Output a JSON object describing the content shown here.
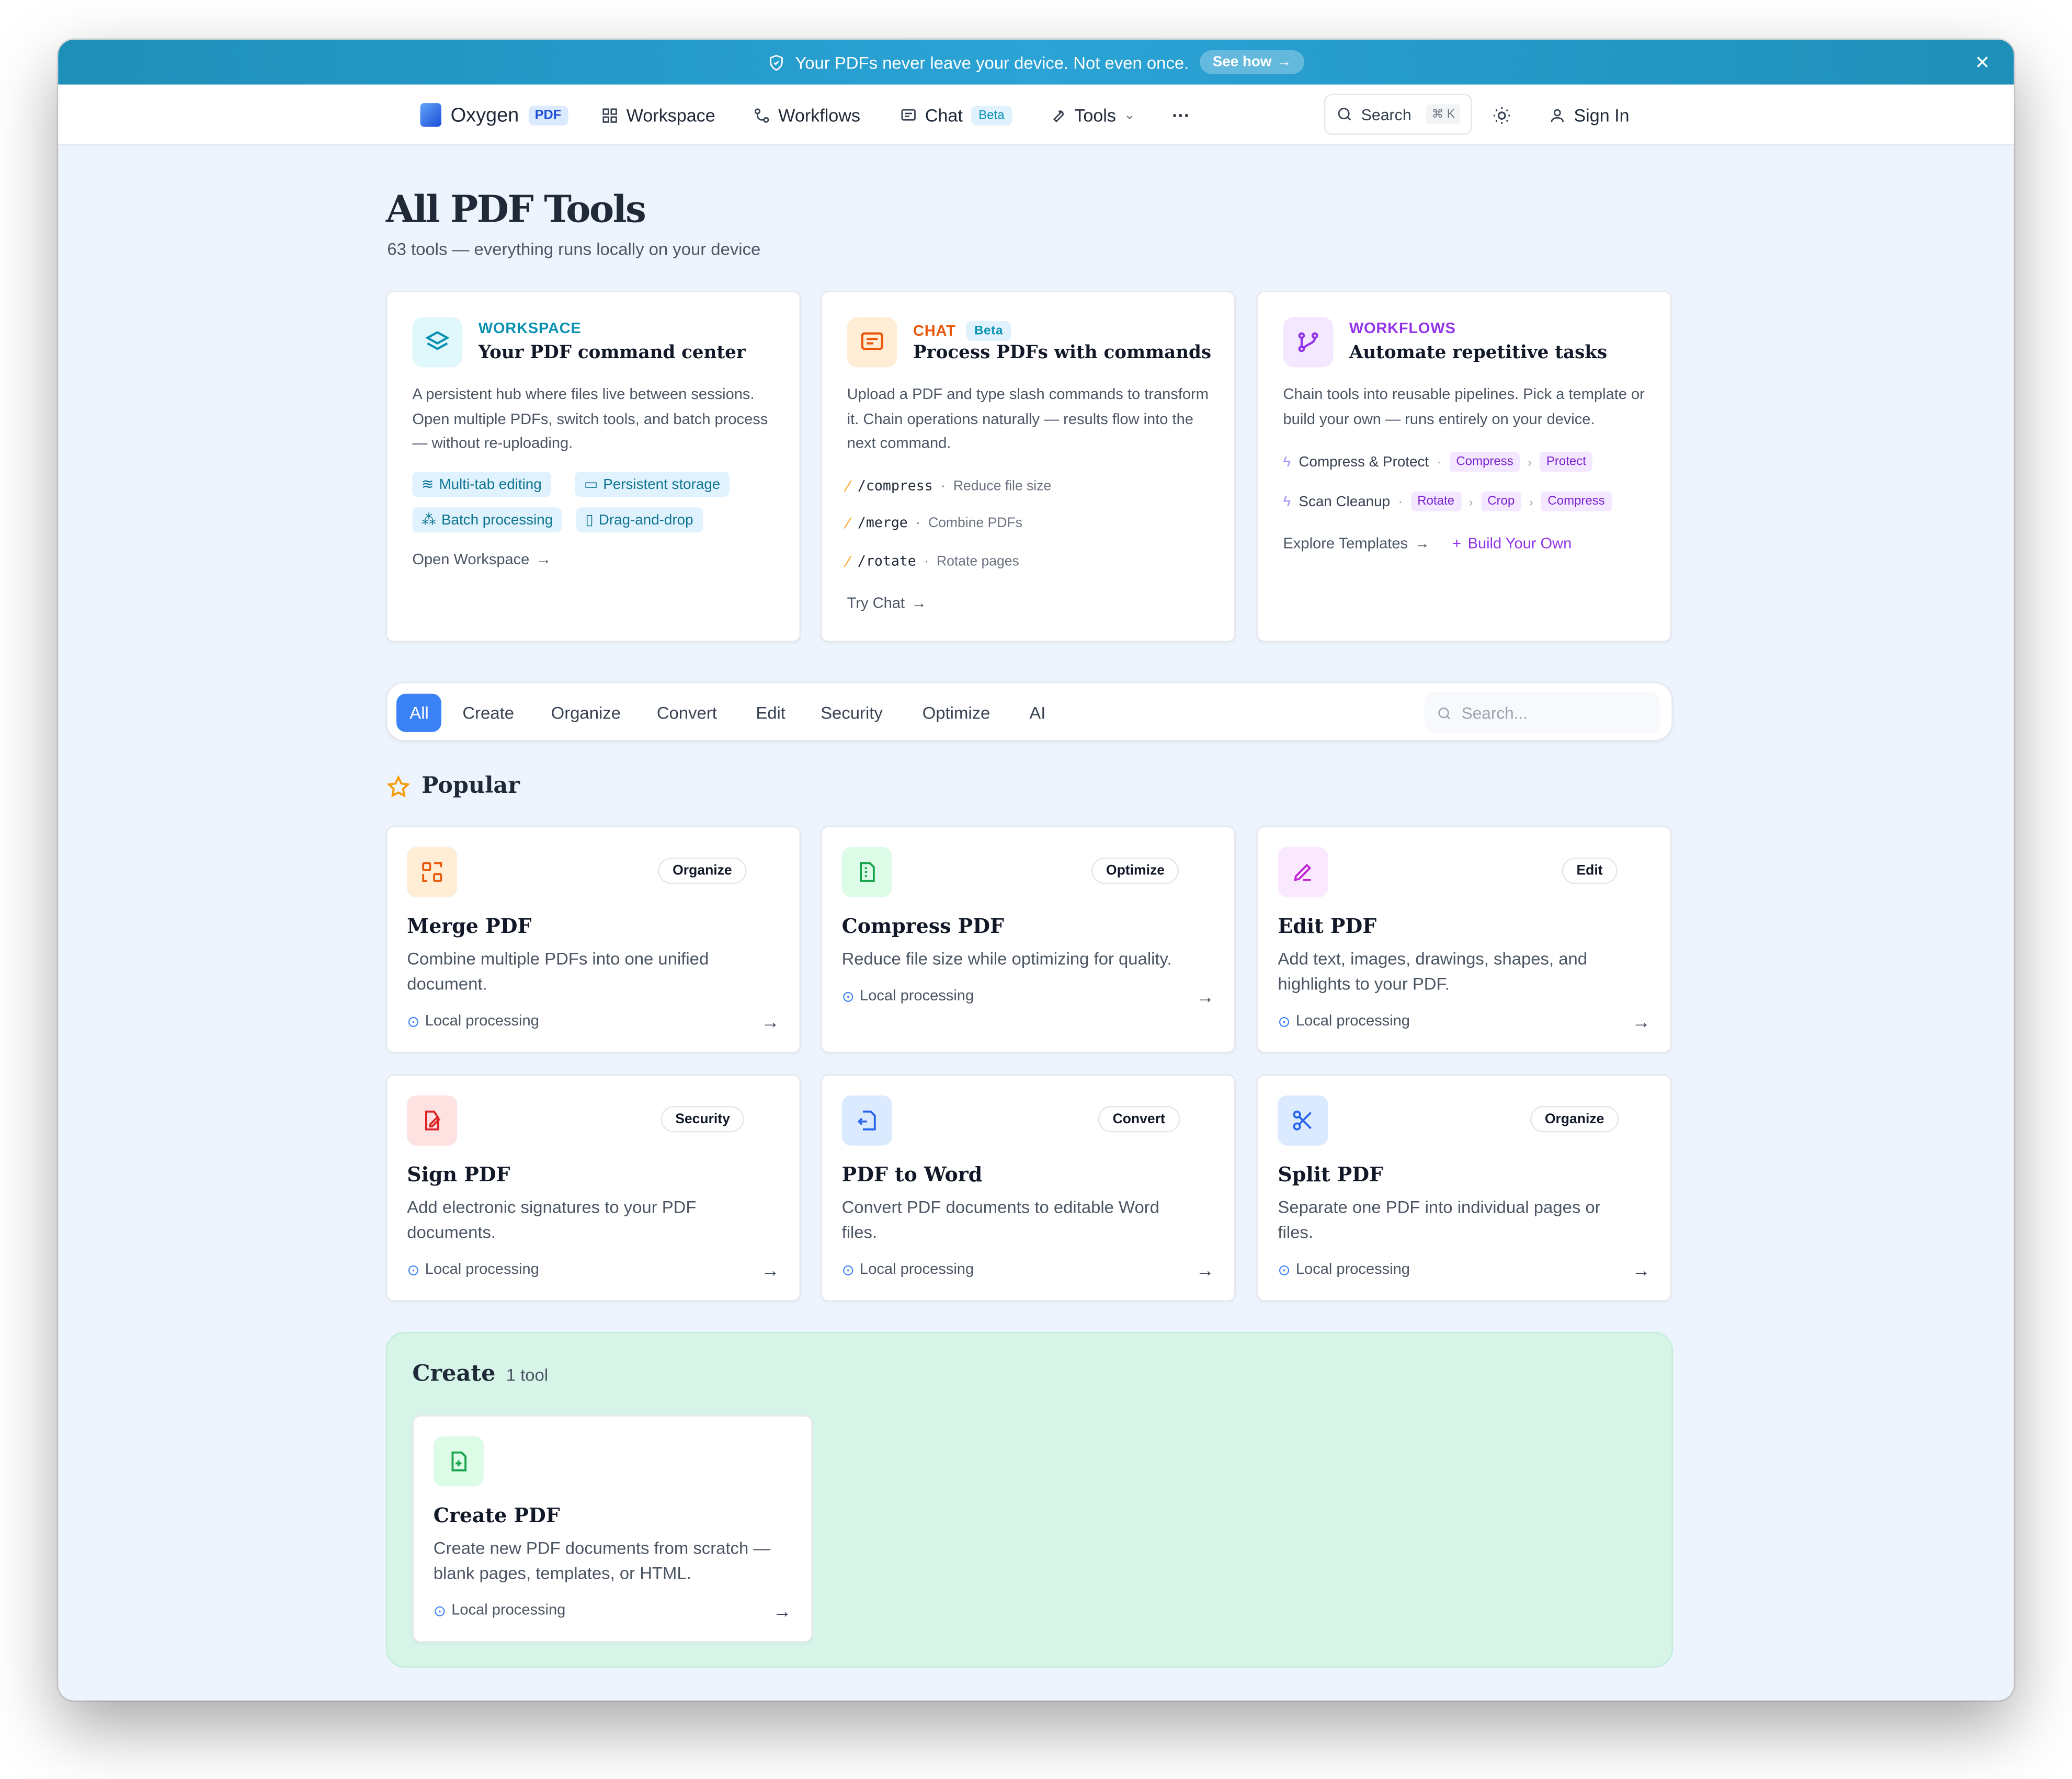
{
  "banner": {
    "text": "Your PDFs never leave your device. Not even once.",
    "see_how": "See how",
    "shield_icon": "shield-icon",
    "close_icon": "close-icon"
  },
  "nav": {
    "brand": "Oxygen",
    "brand_badge": "PDF",
    "workspace": "Workspace",
    "workflows": "Workflows",
    "chat": "Chat",
    "chat_badge": "Beta",
    "tools": "Tools",
    "more": "···",
    "search": "Search",
    "search_shortcut": "⌘ K",
    "sign_in": "Sign In"
  },
  "page": {
    "title": "All PDF Tools",
    "subtitle": "63 tools — everything runs locally on your device"
  },
  "feature_cards": {
    "workspace": {
      "kicker": "WORKSPACE",
      "title": "Your PDF command center",
      "desc": "A persistent hub where files live between sessions. Open multiple PDFs, switch tools, and batch process — without re-uploading.",
      "tags": [
        "Multi-tab editing",
        "Persistent storage",
        "Batch processing",
        "Drag-and-drop"
      ],
      "link": "Open Workspace",
      "color": "#0891b2"
    },
    "chat": {
      "kicker": "CHAT",
      "badge": "Beta",
      "title": "Process PDFs with commands",
      "desc": "Upload a PDF and type slash commands to transform it. Chain operations naturally — results flow into the next command.",
      "commands": [
        {
          "cmd": "/compress",
          "desc": "Reduce file size"
        },
        {
          "cmd": "/merge",
          "desc": "Combine PDFs"
        },
        {
          "cmd": "/rotate",
          "desc": "Rotate pages"
        }
      ],
      "link": "Try Chat",
      "color": "#ea580c"
    },
    "workflows": {
      "kicker": "WORKFLOWS",
      "title": "Automate repetitive tasks",
      "desc": "Chain tools into reusable pipelines. Pick a template or build your own — runs entirely on your device.",
      "pipelines": [
        {
          "name": "Compress & Protect",
          "steps": [
            "Compress",
            "Protect"
          ]
        },
        {
          "name": "Scan Cleanup",
          "steps": [
            "Rotate",
            "Crop",
            "Compress"
          ]
        }
      ],
      "link1": "Explore Templates",
      "link2": "Build Your Own",
      "color": "#9333ea"
    }
  },
  "filters": {
    "tabs": [
      "All",
      "Create",
      "Organize",
      "Convert",
      "Edit",
      "Security",
      "Optimize",
      "AI"
    ],
    "active": "All",
    "search_placeholder": "Search..."
  },
  "popular": {
    "heading": "Popular",
    "tools": [
      {
        "name": "Merge PDF",
        "category": "Organize",
        "desc": "Combine multiple PDFs into one unified document.",
        "badge": "Local processing"
      },
      {
        "name": "Compress PDF",
        "category": "Optimize",
        "desc": "Reduce file size while optimizing for quality.",
        "badge": "Local processing"
      },
      {
        "name": "Edit PDF",
        "category": "Edit",
        "desc": "Add text, images, drawings, shapes, and highlights to your PDF.",
        "badge": "Local processing"
      },
      {
        "name": "Sign PDF",
        "category": "Security",
        "desc": "Add electronic signatures to your PDF documents.",
        "badge": "Local processing"
      },
      {
        "name": "PDF to Word",
        "category": "Convert",
        "desc": "Convert PDF documents to editable Word files.",
        "badge": "Local processing"
      },
      {
        "name": "Split PDF",
        "category": "Organize",
        "desc": "Separate one PDF into individual pages or files.",
        "badge": "Local processing"
      }
    ]
  },
  "create_group": {
    "heading": "Create",
    "count": "1 tool",
    "tool": {
      "name": "Create PDF",
      "desc": "Create new PDF documents from scratch — blank pages, templates, or HTML.",
      "badge": "Local processing"
    }
  }
}
